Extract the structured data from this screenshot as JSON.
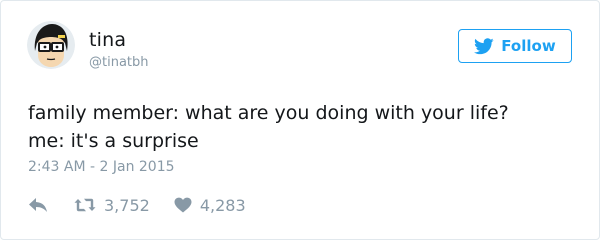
{
  "user": {
    "name": "tina",
    "handle": "@tinatbh"
  },
  "follow_button": {
    "label": "Follow",
    "icon": "twitter-bird-icon"
  },
  "tweet": {
    "lines": [
      "family member: what are you doing with your life?",
      "me: it's a surprise"
    ],
    "timestamp": "2:43 AM - 2 Jan 2015"
  },
  "actions": {
    "reply_icon": "reply-icon",
    "retweet_icon": "retweet-icon",
    "retweet_count": "3,752",
    "like_icon": "heart-icon",
    "like_count": "4,283"
  },
  "colors": {
    "accent": "#1da1f2",
    "muted": "#8899a6",
    "text": "#14171a"
  }
}
